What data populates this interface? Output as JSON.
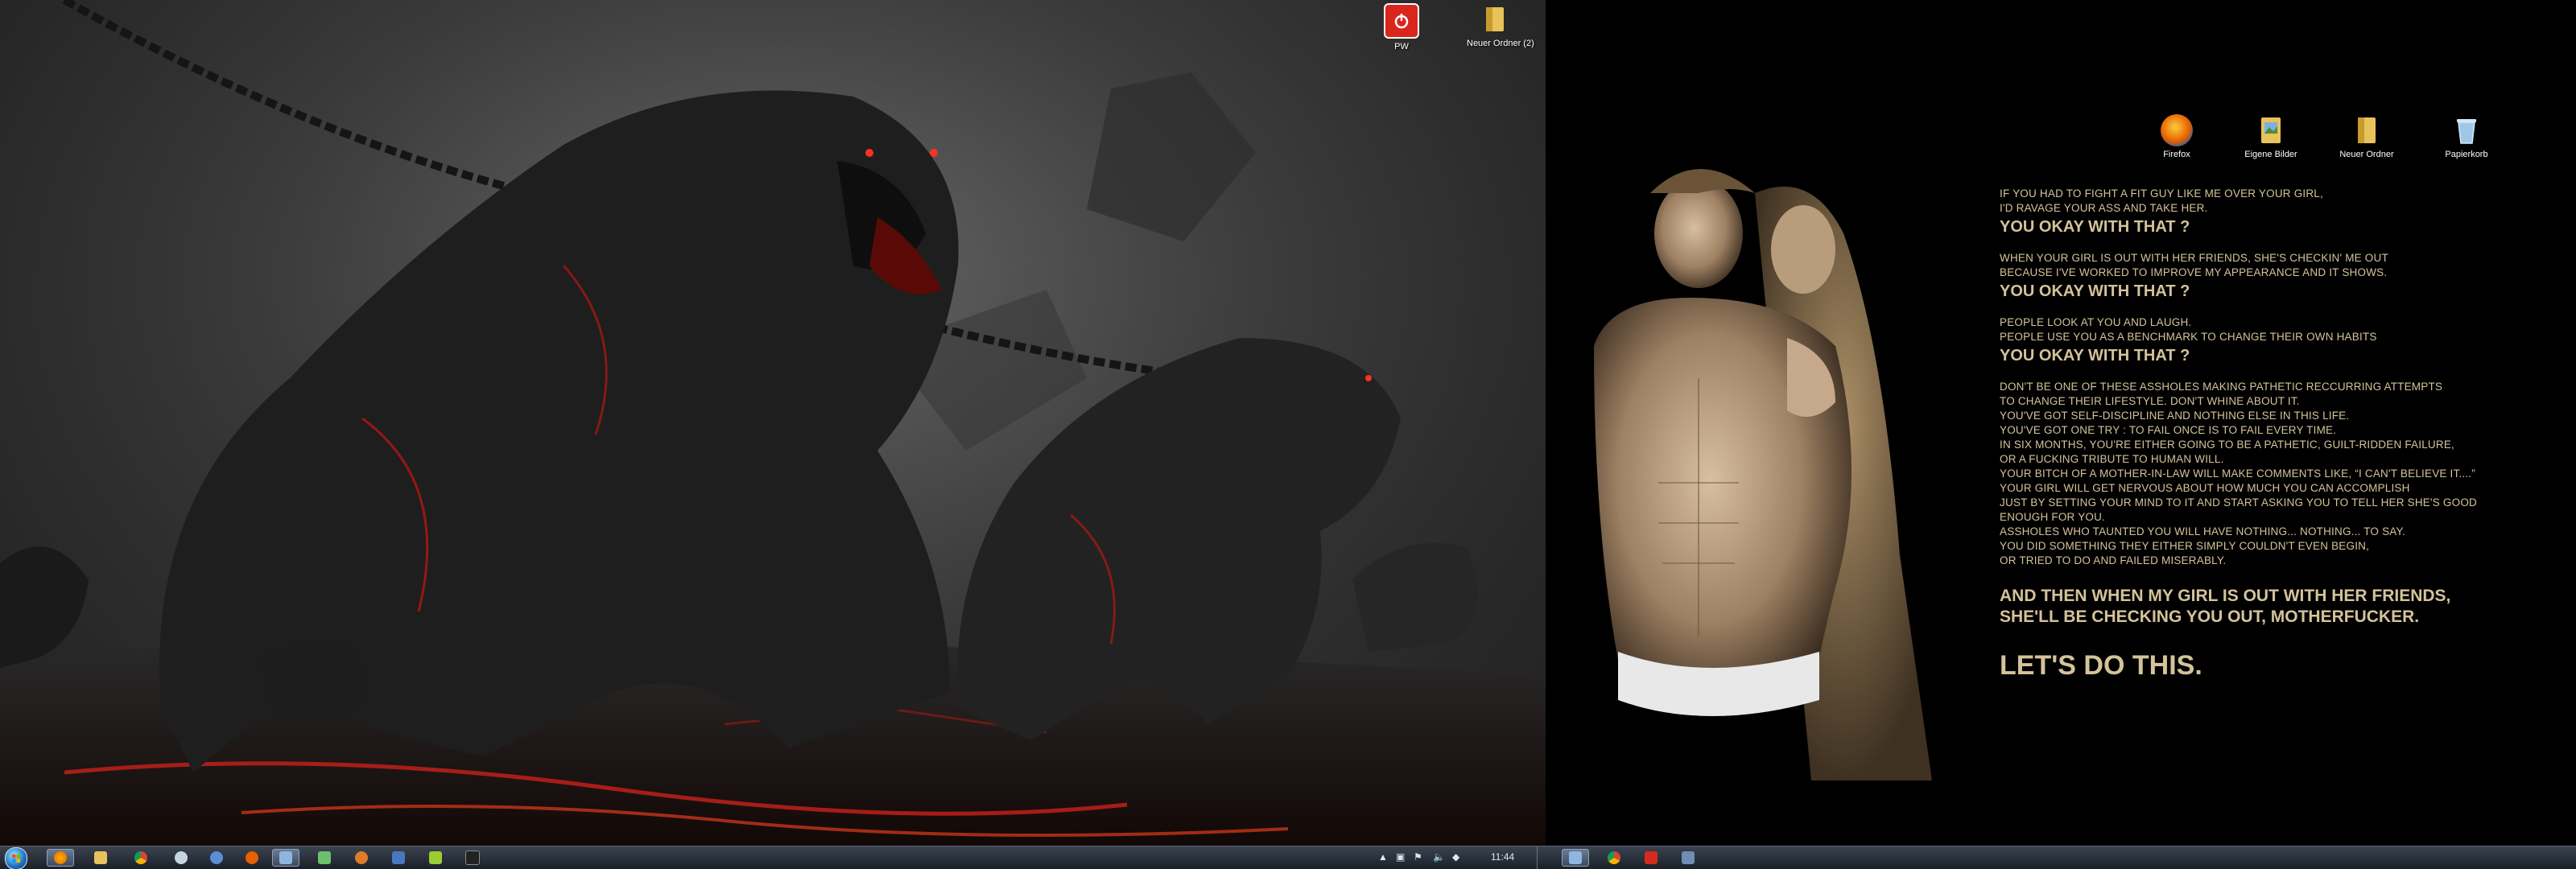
{
  "left_monitor": {
    "wallpaper": "dark fantasy art of chained lava-veined stone gorillas",
    "icons": [
      {
        "icon": "power-icon",
        "label": "PW",
        "color": "#d9261c"
      },
      {
        "icon": "folder-icon",
        "label": "Neuer Ordner (2)",
        "color": "#e8c25a"
      }
    ],
    "taskbar": {
      "start": "start-orb",
      "buttons": [
        "firefox",
        "explorer",
        "chrome",
        "steam",
        "media-player",
        "firefox-alt",
        "monitor",
        "gallery",
        "game",
        "browser",
        "app",
        "terminal"
      ],
      "tray": {
        "time": "11:44"
      }
    }
  },
  "right_monitor": {
    "icons": [
      {
        "icon": "firefox-icon",
        "label": "Firefox",
        "color": "#e66000"
      },
      {
        "icon": "pictures-icon",
        "label": "Eigene Bilder",
        "color": "#7fb0e0"
      },
      {
        "icon": "folder-icon",
        "label": "Neuer Ordner",
        "color": "#e8c25a"
      },
      {
        "icon": "recycle-bin-icon",
        "label": "Papierkorb",
        "color": "#9fc7e8"
      }
    ],
    "quote": {
      "b1_l1": "IF YOU HAD TO FIGHT A FIT GUY LIKE ME OVER YOUR GIRL,",
      "b1_l2": "I'D RAVAGE YOUR ASS AND TAKE HER.",
      "b1_big": "YOU OKAY WITH THAT ?",
      "b2_l1": "WHEN YOUR GIRL IS OUT WITH HER FRIENDS, SHE'S CHECKIN' ME OUT",
      "b2_l2": "BECAUSE I'VE WORKED TO IMPROVE MY APPEARANCE AND IT SHOWS.",
      "b2_big": "YOU OKAY WITH THAT ?",
      "b3_l1": "PEOPLE LOOK AT YOU AND LAUGH.",
      "b3_l2": "PEOPLE USE YOU AS A BENCHMARK TO CHANGE THEIR OWN HABITS",
      "b3_big": "YOU OKAY WITH THAT ?",
      "b4": [
        "DON'T BE ONE OF THESE ASSHOLES MAKING PATHETIC RECCURRING ATTEMPTS",
        "TO CHANGE THEIR LIFESTYLE. DON'T WHINE ABOUT IT.",
        "YOU'VE GOT SELF-DISCIPLINE AND NOTHING ELSE IN THIS LIFE.",
        "YOU'VE GOT ONE TRY : TO FAIL ONCE IS TO FAIL EVERY TIME.",
        "IN SIX MONTHS, YOU'RE EITHER GOING TO BE A PATHETIC, GUILT-RIDDEN FAILURE,",
        "OR A FUCKING TRIBUTE TO HUMAN WILL.",
        "YOUR BITCH OF A MOTHER-IN-LAW WILL MAKE COMMENTS LIKE, “I CAN'T BELIEVE IT....”",
        "YOUR GIRL WILL GET NERVOUS ABOUT HOW MUCH YOU CAN ACCOMPLISH",
        "JUST BY SETTING YOUR MIND TO IT AND START ASKING YOU TO TELL HER SHE'S GOOD",
        "ENOUGH FOR YOU.",
        "ASSHOLES WHO TAUNTED YOU WILL HAVE NOTHING... NOTHING... TO SAY.",
        "YOU DID SOMETHING THEY EITHER SIMPLY COULDN'T EVEN BEGIN,",
        "OR TRIED TO DO AND FAILED MISERABLY."
      ],
      "close_l1": "AND THEN WHEN MY GIRL IS OUT WITH HER FRIENDS,",
      "close_l2": "SHE'LL BE CHECKING YOU OUT, MOTHERFUCKER.",
      "final": "LET'S DO THIS."
    },
    "taskbar": {
      "buttons": [
        "media-player",
        "chrome",
        "pdf-reader",
        "monitor"
      ]
    }
  },
  "colors": {
    "quote_text": "#d4c39a",
    "taskbar": "#1b2028",
    "lava": "#c0201a"
  }
}
